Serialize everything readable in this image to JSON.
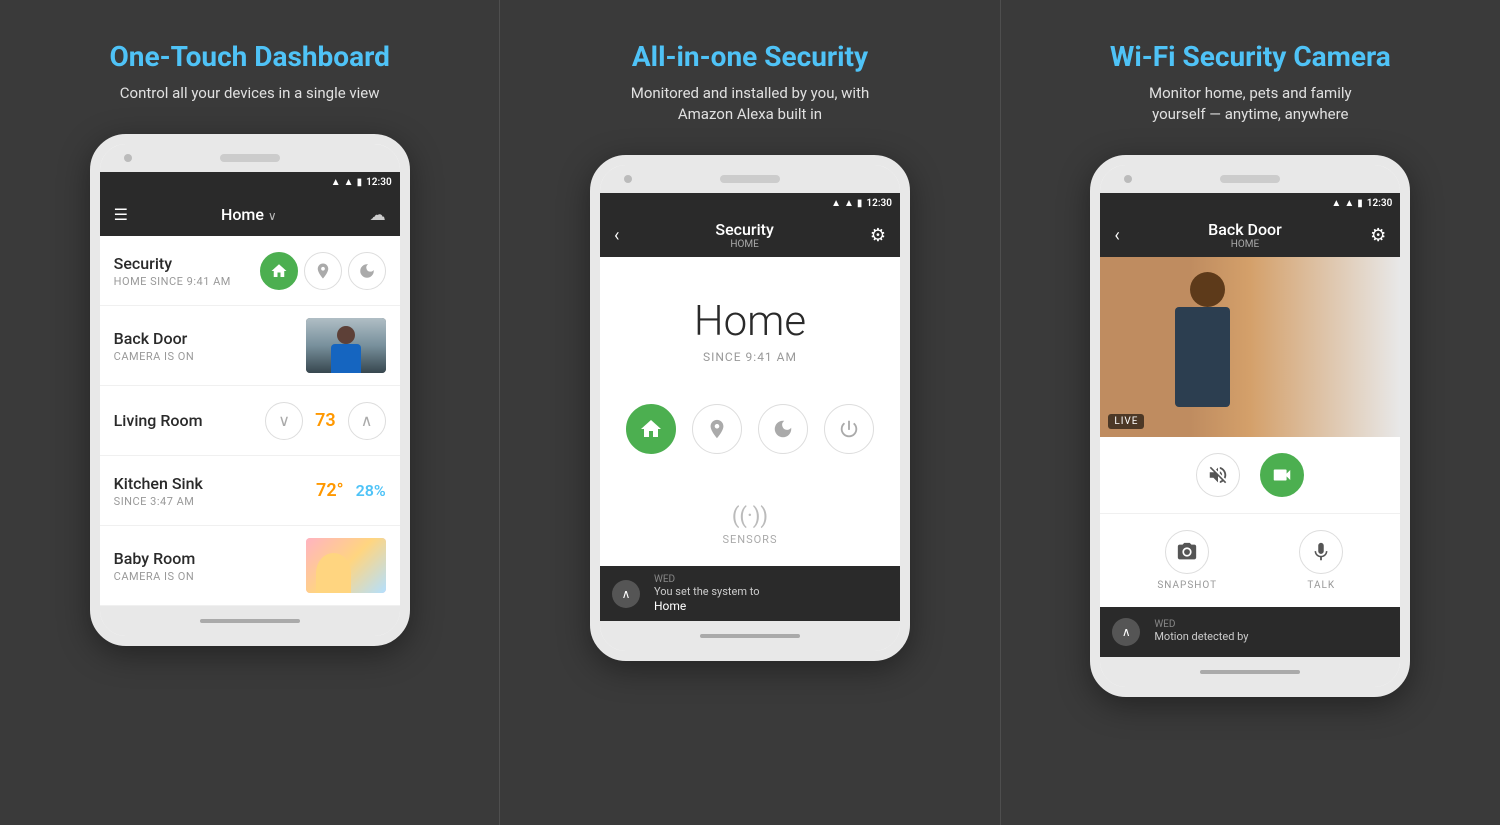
{
  "panels": [
    {
      "id": "dashboard",
      "title": "One-Touch Dashboard",
      "subtitle": "Control all your devices in a single view",
      "phone": {
        "statusBar": {
          "time": "12:30"
        },
        "navBar": {
          "menu": "☰",
          "title": "Home",
          "titleSuffix": "∨",
          "cloud": "☁"
        },
        "devices": [
          {
            "name": "Security",
            "status": "HOME SINCE 9:41 AM",
            "type": "security",
            "controls": [
              "home",
              "away",
              "night"
            ]
          },
          {
            "name": "Back Door",
            "status": "CAMERA IS ON",
            "type": "camera"
          },
          {
            "name": "Living Room",
            "status": "",
            "type": "thermostat",
            "temp": "73"
          },
          {
            "name": "Kitchen Sink",
            "status": "SINCE 3:47 AM",
            "type": "sensor",
            "temp": "72°",
            "humidity": "28%"
          },
          {
            "name": "Baby Room",
            "status": "CAMERA IS ON",
            "type": "camera"
          }
        ]
      }
    },
    {
      "id": "security",
      "title": "All-in-one Security",
      "subtitle": "Monitored and installed by you, with\nAmazon Alexa built in",
      "phone": {
        "statusBar": {
          "time": "12:30"
        },
        "navBar": {
          "back": "‹",
          "title": "Security",
          "subtitle": "HOME",
          "gear": "⚙"
        },
        "screen": {
          "mode": "Home",
          "modeSub": "SINCE 9:41 AM",
          "buttons": [
            "home",
            "away",
            "night",
            "off"
          ],
          "sensorsLabel": "SENSORS"
        },
        "bottomBar": {
          "day": "WED",
          "dot": "●",
          "text": "You set the system to",
          "text2": "Home"
        }
      }
    },
    {
      "id": "camera",
      "title": "Wi-Fi Security Camera",
      "subtitle": "Monitor home, pets and family\nyourself — anytime, anywhere",
      "phone": {
        "statusBar": {
          "time": "12:30"
        },
        "navBar": {
          "back": "‹",
          "title": "Back Door",
          "subtitle": "HOME",
          "gear": "⚙"
        },
        "liveLabel": "LIVE",
        "controls": {
          "mute": "🔇",
          "video": "📹",
          "snapshot": "SNAPSHOT",
          "talk": "TALK"
        },
        "bottomBar": {
          "day": "WED",
          "dot": "●",
          "text": "Motion detected by"
        }
      }
    }
  ]
}
